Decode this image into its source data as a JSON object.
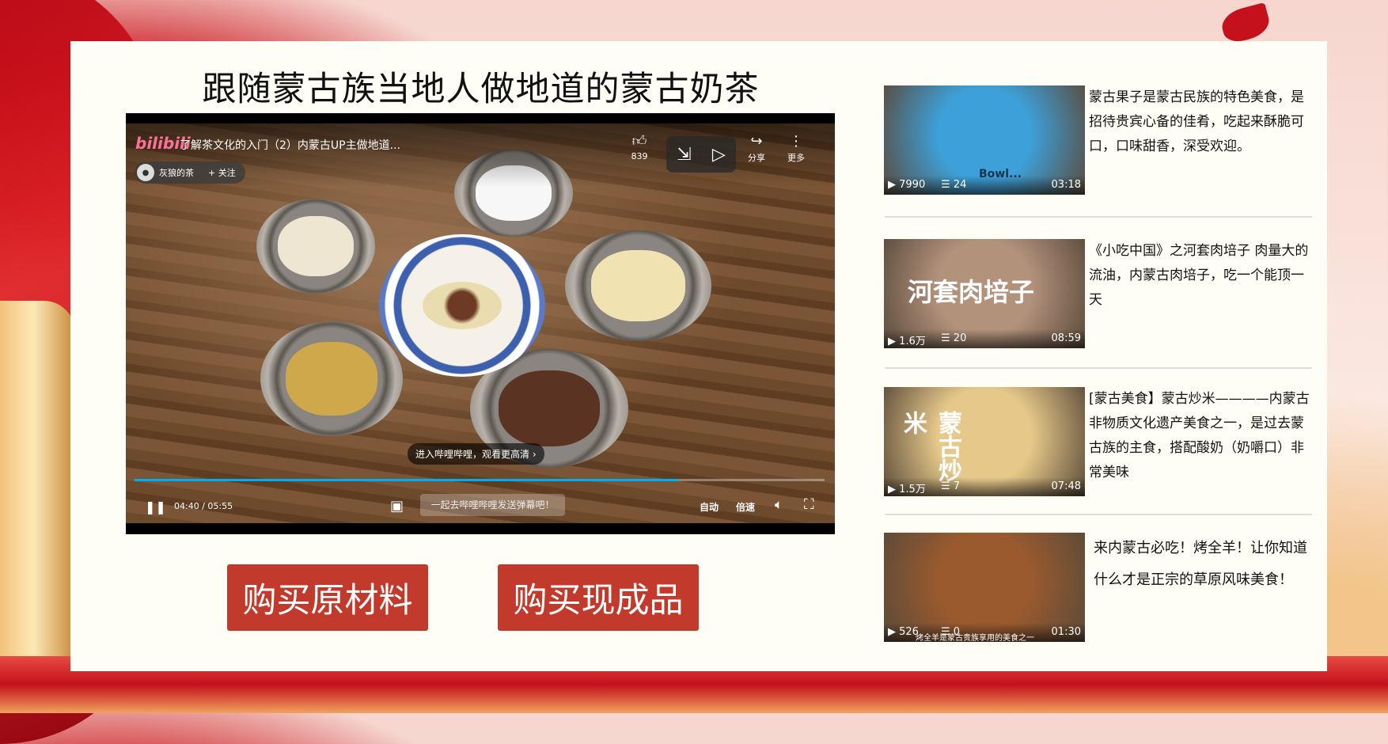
{
  "page": {
    "title": "跟随蒙古族当地人做地道的蒙古奶茶"
  },
  "player": {
    "logo": "bilibili",
    "video_title": "了解茶文化的入门（2）内蒙古UP主做地道...",
    "uploader_name": "灰狼的茶",
    "follow_label": "+ 关注",
    "like_count": "839",
    "share_label": "分享",
    "more_label": "更多",
    "hq_tip": "进入哔哩哔哩，观看更高清 ›",
    "current_time": "04:40",
    "time_separator": "/",
    "duration": "05:55",
    "progress": 0.788,
    "danmu_placeholder": "一起去哔哩哔哩发送弹幕吧！",
    "auto_label": "自动",
    "speed_label": "倍速"
  },
  "buttons": {
    "buy_raw": "购买原材料",
    "buy_made": "购买现成品"
  },
  "recommendations": [
    {
      "views": "7990",
      "comments": "24",
      "duration": "03:18",
      "text": "蒙古果子是蒙古民族的特色美食，是招待贵宾心备的佳肴，吃起来酥脆可口，口味甜香，深受欢迎。",
      "thumb_color": "#3da0d8",
      "thumb_caption": "Bowl..."
    },
    {
      "views": "1.6万",
      "comments": "20",
      "duration": "08:59",
      "text": "《小吃中国》之河套肉培子 肉量大的流油，内蒙古肉培子，吃一个能顶一天",
      "thumb_color": "#b3927c",
      "thumb_caption": "河套肉培子"
    },
    {
      "views": "1.5万",
      "comments": "7",
      "duration": "07:48",
      "text": "[蒙古美食】蒙古炒米————内蒙古非物质文化遗产美食之一，是过去蒙古族的主食，搭配酸奶（奶嚼口）非常美味",
      "thumb_color": "#e6c98a",
      "thumb_caption": "蒙古炒米"
    },
    {
      "views": "526",
      "comments": "0",
      "duration": "01:30",
      "text": "来内蒙古必吃！烤全羊！让你知道什么才是正宗的草原风味美食！",
      "thumb_color": "#9a5a2e",
      "thumb_caption": "烤全羊是蒙古贵族享用的美食之一"
    }
  ]
}
